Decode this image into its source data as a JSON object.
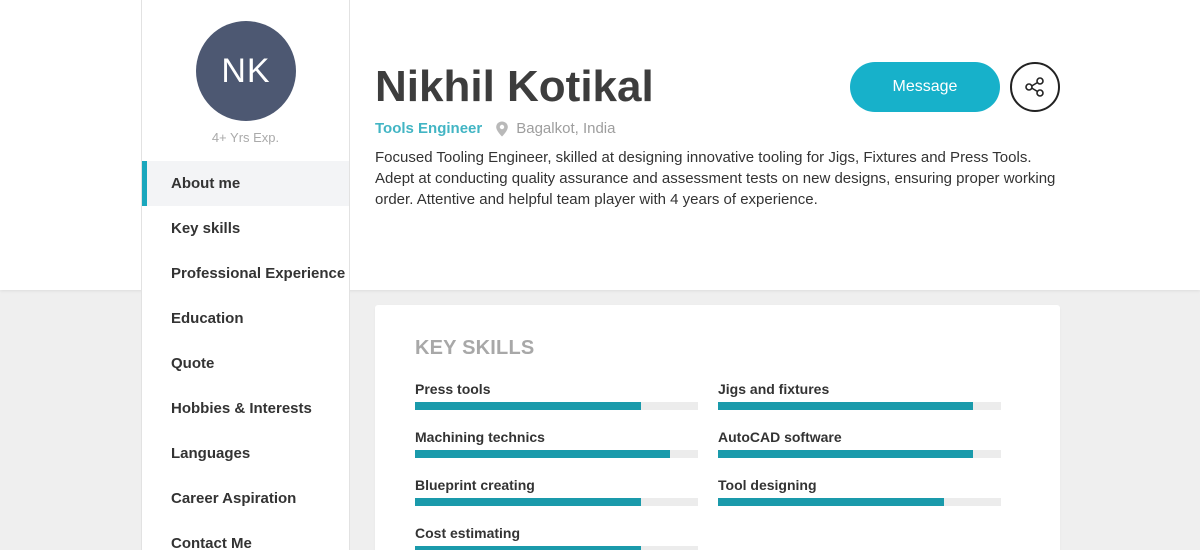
{
  "profile": {
    "initials": "NK",
    "experience": "4+ Yrs Exp.",
    "name": "Nikhil Kotikal",
    "role": "Tools Engineer",
    "location": "Bagalkot, India",
    "bio": "Focused Tooling Engineer, skilled at designing innovative tooling for Jigs, Fixtures and Press Tools. Adept at conducting quality assurance and assessment tests on new designs, ensuring proper working order. Attentive and helpful team player with 4 years of experience."
  },
  "actions": {
    "message_label": "Message",
    "share_icon": "share-icon"
  },
  "nav": {
    "active_index": 0,
    "items": [
      "About me",
      "Key skills",
      "Professional Experience",
      "Education",
      "Quote",
      "Hobbies & Interests",
      "Languages",
      "Career Aspiration",
      "Contact Me"
    ]
  },
  "skills_section": {
    "title": "KEY SKILLS",
    "skills": [
      {
        "name": "Press tools",
        "level": 0.8
      },
      {
        "name": "Jigs and fixtures",
        "level": 0.9
      },
      {
        "name": "Machining technics",
        "level": 0.9
      },
      {
        "name": "AutoCAD software",
        "level": 0.9
      },
      {
        "name": "Blueprint creating",
        "level": 0.8
      },
      {
        "name": "Tool designing",
        "level": 0.8
      },
      {
        "name": "Cost estimating",
        "level": 0.8
      }
    ]
  },
  "colors": {
    "accent": "#17b1ca",
    "avatar_bg": "#4d5872",
    "bar_fill": "#1a9aab",
    "role_text": "#42b5c4"
  }
}
